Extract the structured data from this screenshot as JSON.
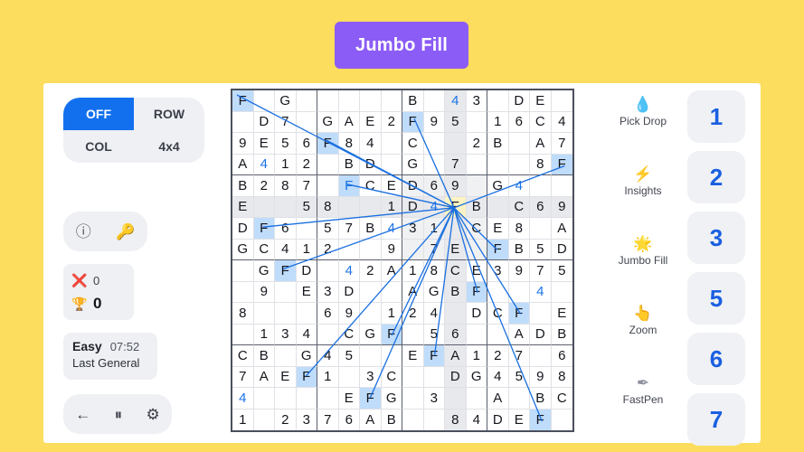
{
  "banner": {
    "title": "Jumbo Fill",
    "bg": "#8b5cf6",
    "page_bg": "#fcdd5d"
  },
  "left_panel": {
    "mode_buttons": [
      {
        "label": "OFF",
        "active": true
      },
      {
        "label": "ROW",
        "active": false
      },
      {
        "label": "COL",
        "active": false
      },
      {
        "label": "4x4",
        "active": false
      }
    ],
    "tools": [
      {
        "name": "info-icon",
        "glyph": "ⓘ"
      },
      {
        "name": "key-icon",
        "glyph": "🔑"
      }
    ],
    "score": {
      "mistakes_icon": "❌",
      "mistakes": "0",
      "trophy_icon": "🏆",
      "score": "0"
    },
    "status": {
      "difficulty": "Easy",
      "timer": "07:52",
      "subtitle": "Last General"
    },
    "controls": [
      {
        "name": "back-button",
        "glyph": "←"
      },
      {
        "name": "pause-button",
        "glyph": "⏸"
      },
      {
        "name": "settings-button",
        "glyph": "⚙"
      }
    ]
  },
  "tool_rail": [
    {
      "label": "Pick Drop",
      "icon": "pick-drop-icon",
      "glyph": "💧",
      "color": "#f5b423"
    },
    {
      "label": "Insights",
      "icon": "insights-icon",
      "glyph": "⚡",
      "color": "#f5b423"
    },
    {
      "label": "Jumbo Fill",
      "icon": "jumbo-fill-icon",
      "glyph": "🌟",
      "color": "#f0b84d"
    },
    {
      "label": "Zoom",
      "icon": "zoom-icon",
      "glyph": "👆",
      "color": "#f5c23a"
    },
    {
      "label": "FastPen",
      "icon": "fastpen-icon",
      "glyph": "✒",
      "color": "#8a8f9c"
    }
  ],
  "numpad": {
    "keys": [
      "1",
      "2",
      "3",
      "5",
      "6",
      "7"
    ],
    "color": "#1a5fe0"
  },
  "grid": {
    "size": 16,
    "box": 4,
    "selected": {
      "row": 5,
      "col": 10,
      "value": "F"
    },
    "accent_blue": "#1a73e8",
    "peer_bg": "#bfdcfb",
    "selected_bg": "#fdf3c4",
    "cells": [
      [
        {
          "v": "F",
          "s": "peer"
        },
        {
          "v": ""
        },
        {
          "v": "G"
        },
        {
          "v": ""
        },
        {
          "v": ""
        },
        {
          "v": ""
        },
        {
          "v": ""
        },
        {
          "v": ""
        },
        {
          "v": "B"
        },
        {
          "v": ""
        },
        {
          "v": "4",
          "c": "blue",
          "s": "cross"
        },
        {
          "v": "3"
        },
        {
          "v": ""
        },
        {
          "v": "D"
        },
        {
          "v": "E"
        },
        {
          "v": ""
        }
      ],
      [
        {
          "v": ""
        },
        {
          "v": "D"
        },
        {
          "v": "7"
        },
        {
          "v": ""
        },
        {
          "v": "G"
        },
        {
          "v": "A"
        },
        {
          "v": "E"
        },
        {
          "v": "2"
        },
        {
          "v": "F",
          "s": "peer"
        },
        {
          "v": "9"
        },
        {
          "v": "5",
          "s": "cross"
        },
        {
          "v": ""
        },
        {
          "v": "1"
        },
        {
          "v": "6"
        },
        {
          "v": "C"
        },
        {
          "v": "4"
        }
      ],
      [
        {
          "v": "9"
        },
        {
          "v": "E"
        },
        {
          "v": "5"
        },
        {
          "v": "6"
        },
        {
          "v": "F",
          "s": "peer"
        },
        {
          "v": "8"
        },
        {
          "v": "4"
        },
        {
          "v": ""
        },
        {
          "v": "C"
        },
        {
          "v": ""
        },
        {
          "v": "",
          "s": "cross"
        },
        {
          "v": "2"
        },
        {
          "v": "B"
        },
        {
          "v": ""
        },
        {
          "v": "A"
        },
        {
          "v": "7"
        }
      ],
      [
        {
          "v": "A"
        },
        {
          "v": "4",
          "c": "blue"
        },
        {
          "v": "1"
        },
        {
          "v": "2"
        },
        {
          "v": ""
        },
        {
          "v": "B"
        },
        {
          "v": "D"
        },
        {
          "v": ""
        },
        {
          "v": "G"
        },
        {
          "v": ""
        },
        {
          "v": "7",
          "s": "cross"
        },
        {
          "v": ""
        },
        {
          "v": ""
        },
        {
          "v": ""
        },
        {
          "v": "8"
        },
        {
          "v": "F",
          "s": "peer"
        }
      ],
      [
        {
          "v": "B"
        },
        {
          "v": "2"
        },
        {
          "v": "8"
        },
        {
          "v": "7"
        },
        {
          "v": ""
        },
        {
          "v": "F",
          "c": "blue",
          "s": "peer"
        },
        {
          "v": "C"
        },
        {
          "v": "E"
        },
        {
          "v": "D",
          "s": "box"
        },
        {
          "v": "6",
          "s": "box"
        },
        {
          "v": "9",
          "s": "cross"
        },
        {
          "v": "",
          "s": "box"
        },
        {
          "v": "G"
        },
        {
          "v": "4",
          "c": "blue"
        },
        {
          "v": ""
        },
        {
          "v": ""
        }
      ],
      [
        {
          "v": "E",
          "s": "cross"
        },
        {
          "v": "",
          "s": "cross"
        },
        {
          "v": "",
          "s": "cross"
        },
        {
          "v": "5",
          "s": "cross"
        },
        {
          "v": "8",
          "s": "cross"
        },
        {
          "v": "",
          "s": "cross"
        },
        {
          "v": "",
          "s": "cross"
        },
        {
          "v": "1",
          "s": "cross"
        },
        {
          "v": "D",
          "s": "cross"
        },
        {
          "v": "4",
          "c": "blue",
          "s": "cross"
        },
        {
          "v": "F",
          "s": "sel"
        },
        {
          "v": "B",
          "s": "cross"
        },
        {
          "v": "",
          "s": "cross"
        },
        {
          "v": "C",
          "s": "cross"
        },
        {
          "v": "6",
          "s": "cross"
        },
        {
          "v": "9",
          "s": "cross"
        }
      ],
      [
        {
          "v": "D"
        },
        {
          "v": "F",
          "s": "peer"
        },
        {
          "v": "6"
        },
        {
          "v": ""
        },
        {
          "v": "5"
        },
        {
          "v": "7"
        },
        {
          "v": "B"
        },
        {
          "v": "4",
          "c": "blue"
        },
        {
          "v": "3",
          "s": "box"
        },
        {
          "v": "1",
          "s": "box"
        },
        {
          "v": "",
          "s": "cross"
        },
        {
          "v": "C",
          "s": "box"
        },
        {
          "v": "E"
        },
        {
          "v": "8"
        },
        {
          "v": ""
        },
        {
          "v": "A"
        }
      ],
      [
        {
          "v": "G"
        },
        {
          "v": "C"
        },
        {
          "v": "4"
        },
        {
          "v": "1"
        },
        {
          "v": "2"
        },
        {
          "v": ""
        },
        {
          "v": ""
        },
        {
          "v": "9"
        },
        {
          "v": "",
          "s": "box"
        },
        {
          "v": "7",
          "s": "box"
        },
        {
          "v": "E",
          "s": "cross"
        },
        {
          "v": "",
          "s": "box"
        },
        {
          "v": "F",
          "s": "peer"
        },
        {
          "v": "B"
        },
        {
          "v": "5"
        },
        {
          "v": "D"
        }
      ],
      [
        {
          "v": ""
        },
        {
          "v": "G"
        },
        {
          "v": "F",
          "s": "peer"
        },
        {
          "v": "D"
        },
        {
          "v": ""
        },
        {
          "v": "4",
          "c": "blue"
        },
        {
          "v": "2"
        },
        {
          "v": "A"
        },
        {
          "v": "1"
        },
        {
          "v": "8"
        },
        {
          "v": "C",
          "s": "cross"
        },
        {
          "v": "E"
        },
        {
          "v": "3"
        },
        {
          "v": "9"
        },
        {
          "v": "7"
        },
        {
          "v": "5"
        }
      ],
      [
        {
          "v": ""
        },
        {
          "v": "9"
        },
        {
          "v": ""
        },
        {
          "v": "E"
        },
        {
          "v": "3"
        },
        {
          "v": "D"
        },
        {
          "v": ""
        },
        {
          "v": ""
        },
        {
          "v": "A"
        },
        {
          "v": "G"
        },
        {
          "v": "B",
          "s": "cross"
        },
        {
          "v": "F",
          "s": "peer"
        },
        {
          "v": ""
        },
        {
          "v": ""
        },
        {
          "v": "4",
          "c": "blue"
        },
        {
          "v": ""
        }
      ],
      [
        {
          "v": "8"
        },
        {
          "v": ""
        },
        {
          "v": ""
        },
        {
          "v": ""
        },
        {
          "v": "6"
        },
        {
          "v": "9"
        },
        {
          "v": ""
        },
        {
          "v": "1"
        },
        {
          "v": "2"
        },
        {
          "v": "4"
        },
        {
          "v": "",
          "s": "cross"
        },
        {
          "v": "D"
        },
        {
          "v": "C"
        },
        {
          "v": "F",
          "s": "peer"
        },
        {
          "v": ""
        },
        {
          "v": "E"
        }
      ],
      [
        {
          "v": ""
        },
        {
          "v": "1"
        },
        {
          "v": "3"
        },
        {
          "v": "4"
        },
        {
          "v": ""
        },
        {
          "v": "C"
        },
        {
          "v": "G"
        },
        {
          "v": "F",
          "s": "peer"
        },
        {
          "v": ""
        },
        {
          "v": "5"
        },
        {
          "v": "6",
          "s": "cross"
        },
        {
          "v": ""
        },
        {
          "v": ""
        },
        {
          "v": "A"
        },
        {
          "v": "D"
        },
        {
          "v": "B"
        }
      ],
      [
        {
          "v": "C"
        },
        {
          "v": "B"
        },
        {
          "v": ""
        },
        {
          "v": "G"
        },
        {
          "v": "4"
        },
        {
          "v": "5"
        },
        {
          "v": ""
        },
        {
          "v": ""
        },
        {
          "v": "E"
        },
        {
          "v": "F",
          "s": "peer"
        },
        {
          "v": "A",
          "s": "cross"
        },
        {
          "v": "1"
        },
        {
          "v": "2"
        },
        {
          "v": "7"
        },
        {
          "v": ""
        },
        {
          "v": "6"
        }
      ],
      [
        {
          "v": "7"
        },
        {
          "v": "A"
        },
        {
          "v": "E"
        },
        {
          "v": "F",
          "s": "peer"
        },
        {
          "v": "1"
        },
        {
          "v": ""
        },
        {
          "v": "3"
        },
        {
          "v": "C"
        },
        {
          "v": ""
        },
        {
          "v": ""
        },
        {
          "v": "D",
          "s": "cross"
        },
        {
          "v": "G"
        },
        {
          "v": "4"
        },
        {
          "v": "5"
        },
        {
          "v": "9"
        },
        {
          "v": "8"
        }
      ],
      [
        {
          "v": "4",
          "c": "blue"
        },
        {
          "v": ""
        },
        {
          "v": ""
        },
        {
          "v": ""
        },
        {
          "v": ""
        },
        {
          "v": "E"
        },
        {
          "v": "F",
          "s": "peer"
        },
        {
          "v": "G"
        },
        {
          "v": ""
        },
        {
          "v": "3"
        },
        {
          "v": "",
          "s": "cross"
        },
        {
          "v": ""
        },
        {
          "v": "A"
        },
        {
          "v": ""
        },
        {
          "v": "B"
        },
        {
          "v": "C"
        }
      ],
      [
        {
          "v": "1"
        },
        {
          "v": ""
        },
        {
          "v": "2"
        },
        {
          "v": "3"
        },
        {
          "v": "7"
        },
        {
          "v": "6"
        },
        {
          "v": "A"
        },
        {
          "v": "B"
        },
        {
          "v": ""
        },
        {
          "v": ""
        },
        {
          "v": "8",
          "s": "cross"
        },
        {
          "v": "4"
        },
        {
          "v": "D"
        },
        {
          "v": "E"
        },
        {
          "v": "F",
          "s": "peer"
        },
        {
          "v": ""
        }
      ]
    ],
    "connector_lines": {
      "origin": {
        "col": 10.4,
        "row": 5.55
      },
      "targets": [
        {
          "col": 0.3,
          "row": 0.3
        },
        {
          "col": 15.55,
          "row": 3.6
        },
        {
          "col": 5.4,
          "row": 4.45
        },
        {
          "col": 4.45,
          "row": 2.4
        },
        {
          "col": 1.5,
          "row": 6.45
        },
        {
          "col": 12.4,
          "row": 7.5
        },
        {
          "col": 2.45,
          "row": 8.4
        },
        {
          "col": 11.5,
          "row": 9.5
        },
        {
          "col": 13.5,
          "row": 10.5
        },
        {
          "col": 7.5,
          "row": 11.5
        },
        {
          "col": 9.5,
          "row": 12.4
        },
        {
          "col": 3.5,
          "row": 13.4
        },
        {
          "col": 6.5,
          "row": 14.4
        },
        {
          "col": 14.5,
          "row": 15.5
        },
        {
          "col": 8.55,
          "row": 1.4
        }
      ]
    }
  }
}
